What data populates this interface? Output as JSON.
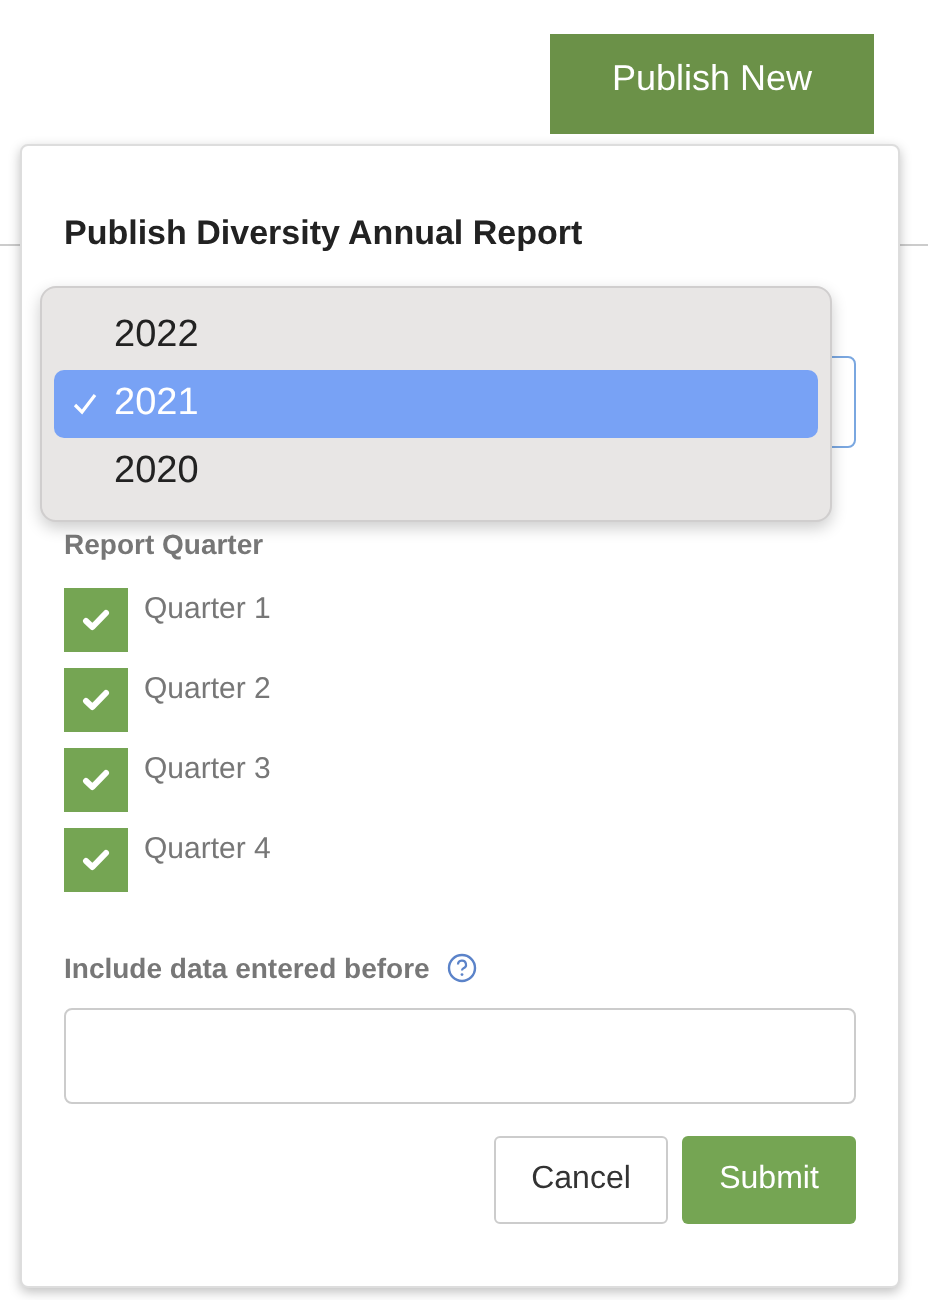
{
  "publish_button": {
    "label": "Publish New"
  },
  "dialog": {
    "title": "Publish Diversity Annual Report",
    "year_dropdown": {
      "options": [
        {
          "label": "2022",
          "selected": false
        },
        {
          "label": "2021",
          "selected": true
        },
        {
          "label": "2020",
          "selected": false
        }
      ]
    },
    "quarter_label": "Report Quarter",
    "quarters": [
      {
        "label": "Quarter 1",
        "checked": true
      },
      {
        "label": "Quarter 2",
        "checked": true
      },
      {
        "label": "Quarter 3",
        "checked": true
      },
      {
        "label": "Quarter 4",
        "checked": true
      }
    ],
    "date_field": {
      "label": "Include data entered before"
    },
    "buttons": [
      {
        "label": "Cancel",
        "kind": "secondary"
      },
      {
        "label": "Submit",
        "kind": "primary"
      }
    ]
  }
}
